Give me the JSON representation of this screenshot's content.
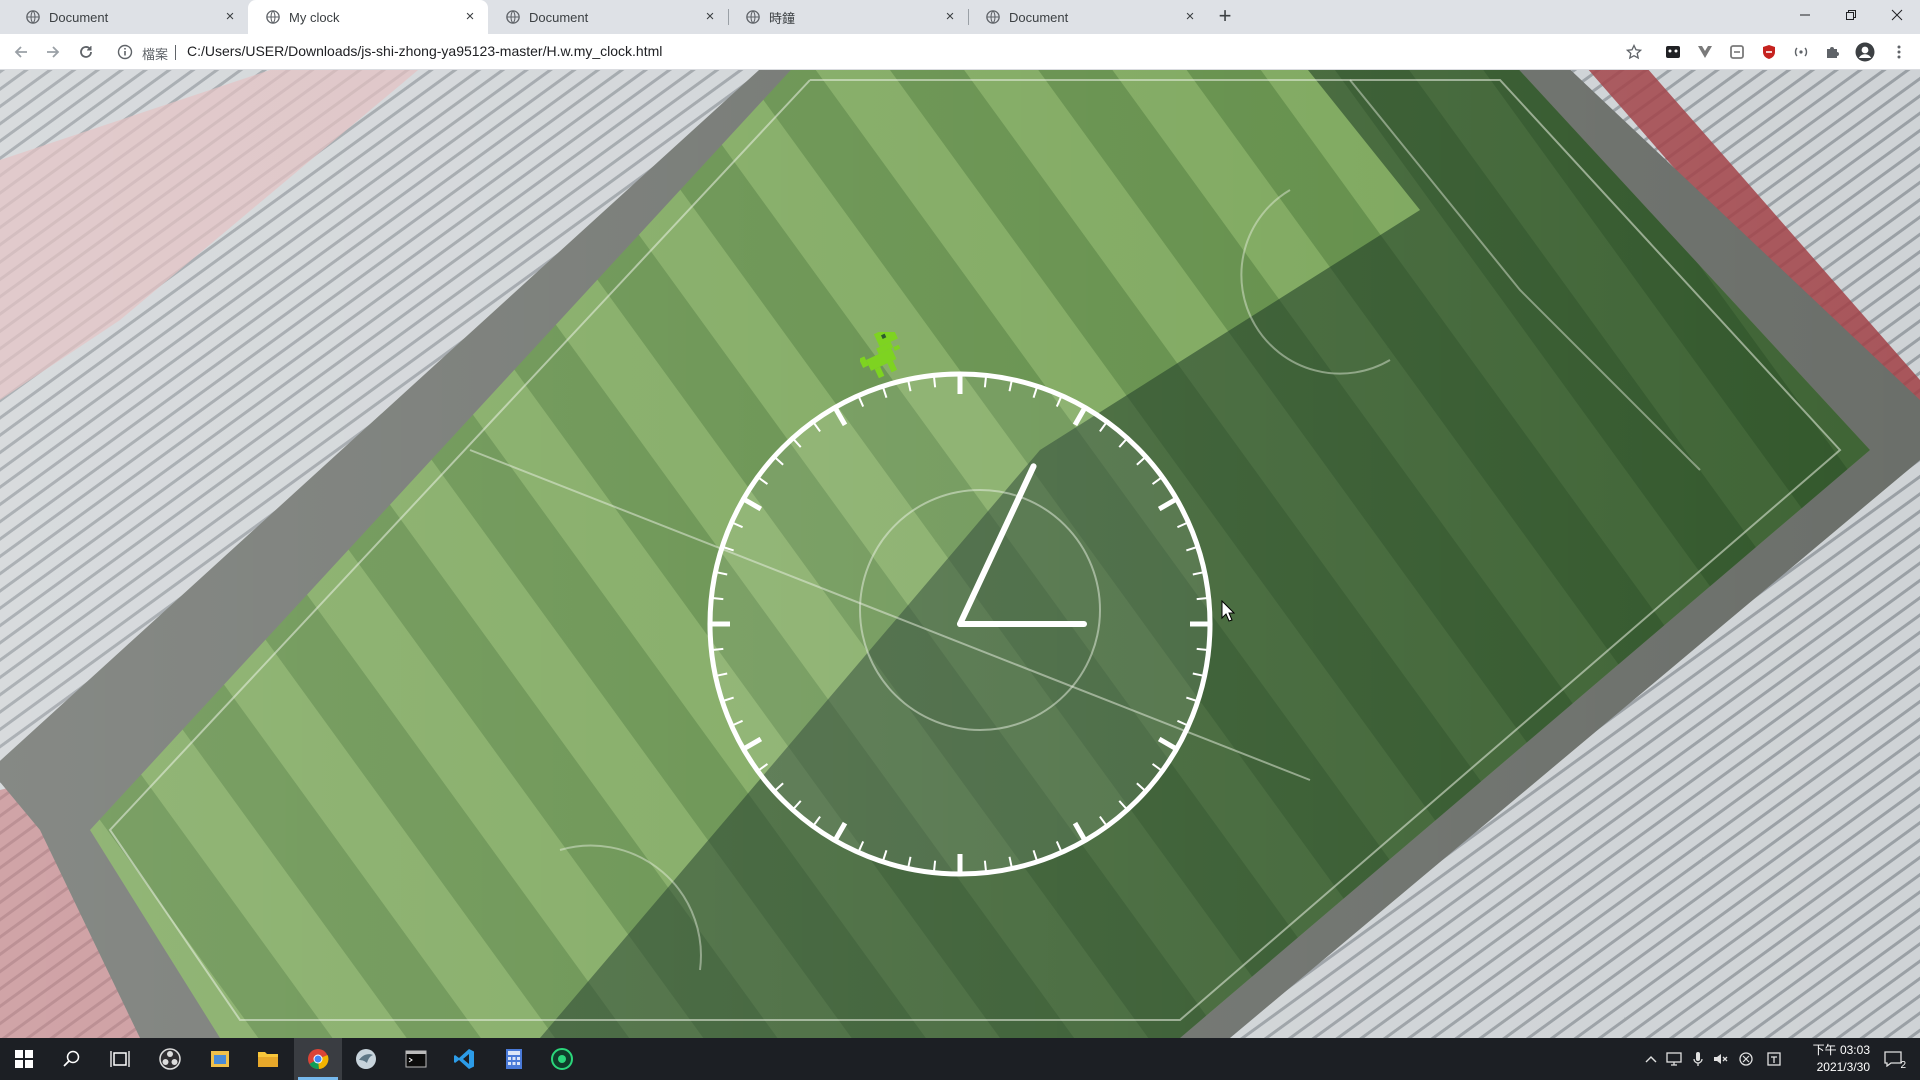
{
  "browser": {
    "tabs": [
      {
        "label": "Document",
        "active": false
      },
      {
        "label": "My clock",
        "active": true
      },
      {
        "label": "Document",
        "active": false
      },
      {
        "label": "時鐘",
        "active": false
      },
      {
        "label": "Document",
        "active": false
      }
    ],
    "tab_close_glyph": "×",
    "new_tab_glyph": "+",
    "address": {
      "scheme_label": "檔案",
      "url": "C:/Users/USER/Downloads/js-shi-zhong-ya95123-master/H.w.my_clock.html"
    }
  },
  "clock": {
    "ticks": 60,
    "hour_hand_angle_deg": 90,
    "minute_hand_angle_deg": 25
  },
  "taskbar": {
    "time": "下午 03:03",
    "date": "2021/3/30",
    "notification_count": "2",
    "icons": [
      "windows-start-icon",
      "search-icon",
      "task-view-icon",
      "obs-icon",
      "file-manager-icon",
      "file-explorer-icon",
      "chrome-icon",
      "bird-app-icon",
      "terminal-icon",
      "vscode-icon",
      "calculator-icon",
      "green-circle-app-icon"
    ]
  },
  "colors": {
    "tabstrip": "#dee1e6",
    "pitch_dark": "#2d5a2e",
    "pitch_light": "#6d9a52",
    "clock_white": "#ffffff",
    "dino_green": "#7ed321"
  }
}
